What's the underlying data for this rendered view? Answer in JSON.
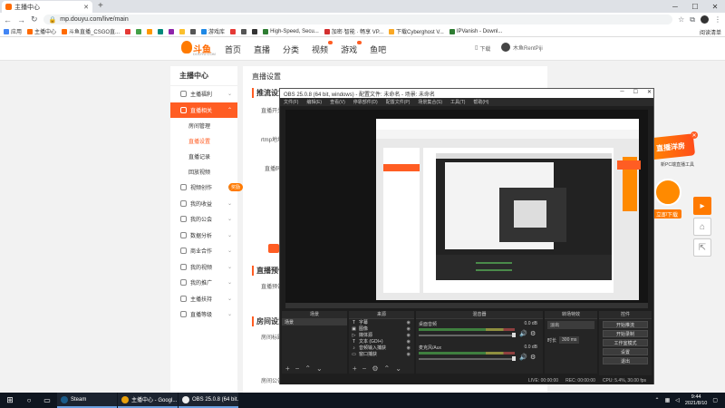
{
  "browser": {
    "tab_title": "主播中心",
    "url": "mp.douyu.com/live/main",
    "bookmarks": [
      "应用",
      "主播中心",
      "斗鱼直播_CSGO直...",
      "",
      "",
      "",
      "",
      "",
      "",
      "",
      "游戏库",
      "",
      "",
      "",
      "High-Speed, Secu...",
      "加密·智能 · 畅享 VP...",
      "下载Cyberghost V...",
      "IPVanish - Downl..."
    ],
    "bookmarks_right": "阅读清单"
  },
  "douyu": {
    "logo_text": "斗鱼",
    "logo_sub": "DOUYU.COM",
    "nav": [
      "首页",
      "直播",
      "分类",
      "视频",
      "游戏",
      "鱼吧"
    ],
    "download": "下载",
    "username": "木鱼RentPiji",
    "side_title": "主播中心",
    "side_items": [
      {
        "label": "主播福利",
        "active": false
      },
      {
        "label": "直播相关",
        "active": true
      }
    ],
    "side_subs": [
      "房间管理",
      "直播设置",
      "直播记录",
      "回放视频"
    ],
    "side_items2": [
      {
        "label": "视频创作",
        "badge": "奖励"
      },
      {
        "label": "我的收益"
      },
      {
        "label": "我的公会"
      },
      {
        "label": "数据分析"
      },
      {
        "label": "商业合作"
      },
      {
        "label": "我的视频"
      },
      {
        "label": "我的推广"
      },
      {
        "label": "主播扶持"
      },
      {
        "label": "直播等级"
      }
    ],
    "main_title": "直播设置",
    "sections": [
      "推流设置",
      "直播预告",
      "房间设置"
    ],
    "labels": [
      "直播开关",
      "rtmp地址",
      "直播码",
      "直播预告",
      "房间标题",
      "房间公告"
    ]
  },
  "ad": {
    "banner": "直播洋房",
    "text": "新PC端直播工具",
    "button": "立即下载"
  },
  "obs": {
    "title": "OBS 25.0.8 (64 bit, windows) - 配置文件: 未命名 - 场景: 未命名",
    "menu": [
      "文件(F)",
      "编辑(E)",
      "查看(V)",
      "停靠部件(D)",
      "配置文件(P)",
      "场景集合(S)",
      "工具(T)",
      "帮助(H)"
    ],
    "docks": [
      "场景",
      "来源",
      "混音器",
      "转场特效",
      "控件"
    ],
    "scene": "场景",
    "sources": [
      "字幕",
      "图像",
      "媒体源",
      "文本 (GDI+)",
      "音频输入捕获",
      "窗口捕获"
    ],
    "mixer": [
      {
        "name": "桌面音频",
        "level": "0.0 dB"
      },
      {
        "name": "麦克风/Aux",
        "level": "0.0 dB"
      }
    ],
    "transition": {
      "type": "淡出",
      "duration_label": "时长",
      "duration": "300 ms"
    },
    "controls": [
      "开始推流",
      "开始录制",
      "工作室模式",
      "设置",
      "退出"
    ],
    "status": [
      "LIVE: 00:00:00",
      "REC: 00:00:00",
      "CPU: 5.4%, 30.00 fps"
    ]
  },
  "taskbar": {
    "apps": [
      {
        "label": "Steam",
        "color": "#1b5c8a"
      },
      {
        "label": "主播中心 - Googl...",
        "color": "#e8a00b"
      },
      {
        "label": "OBS 25.0.8 (64 bit...",
        "color": "#eeeeee"
      }
    ],
    "time": "9:44",
    "date": "2021/8/10"
  }
}
